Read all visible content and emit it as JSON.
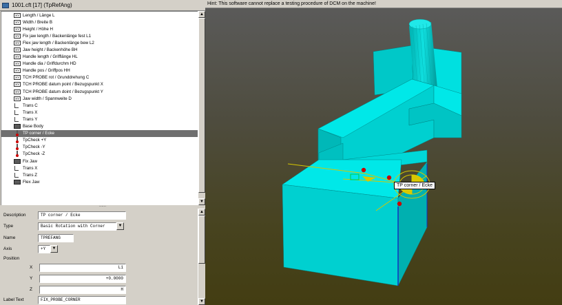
{
  "window": {
    "title": "1001.cft   [17]  (TpRefAng)"
  },
  "tree": {
    "items": [
      {
        "label": "Length / Länge L",
        "icon": "xy-variable-icon",
        "selected": false
      },
      {
        "label": "Width / Breite B",
        "icon": "xy-variable-icon",
        "selected": false
      },
      {
        "label": "Height / Höhe H",
        "icon": "xy-variable-icon",
        "selected": false
      },
      {
        "label": "Fix jaw length / Backenlänge fest L1",
        "icon": "xy-variable-icon",
        "selected": false
      },
      {
        "label": "Flex jaw length / Backenlänge bew L2",
        "icon": "xy-variable-icon",
        "selected": false
      },
      {
        "label": "Jaw height / Backenhöhe BH",
        "icon": "xy-variable-icon",
        "selected": false
      },
      {
        "label": "Handle length / Grifflänge HL",
        "icon": "xy-variable-icon",
        "selected": false
      },
      {
        "label": "Handle dia / Griffdurchm HD",
        "icon": "xy-variable-icon",
        "selected": false
      },
      {
        "label": "Handle pos / Griffpos HH",
        "icon": "xy-variable-icon",
        "selected": false
      },
      {
        "label": "TCH PROBE rot / Grunddrehung C",
        "icon": "xy-variable-icon",
        "selected": false
      },
      {
        "label": "TCH PROBE datum point / Bezugspunkt X",
        "icon": "xy-variable-icon",
        "selected": false
      },
      {
        "label": "TCH PROBE datum doint / Bezugspunkt Y",
        "icon": "xy-variable-icon",
        "selected": false
      },
      {
        "label": "Jaw width / Spannweite D",
        "icon": "xy-variable-icon",
        "selected": false
      },
      {
        "label": "Trans C",
        "icon": "transform-icon",
        "selected": false
      },
      {
        "label": "Trans X",
        "icon": "transform-icon",
        "selected": false
      },
      {
        "label": "Trans Y",
        "icon": "transform-icon",
        "selected": false
      },
      {
        "label": "Base Body",
        "icon": "body-icon",
        "selected": false
      },
      {
        "label": "TP corner / Ecke",
        "icon": "probe-icon",
        "selected": true
      },
      {
        "label": "TpCheck +Y",
        "icon": "probe-icon",
        "selected": false
      },
      {
        "label": "TpCheck -Y",
        "icon": "probe-icon",
        "selected": false
      },
      {
        "label": "TpCheck -Z",
        "icon": "probe-icon",
        "selected": false
      },
      {
        "label": "Fix Jaw",
        "icon": "body-icon",
        "selected": false
      },
      {
        "label": "Trans X",
        "icon": "transform-icon",
        "selected": false
      },
      {
        "label": "Trans Z",
        "icon": "transform-icon",
        "selected": false
      },
      {
        "label": "Flex Jaw",
        "icon": "body-icon",
        "selected": false
      }
    ]
  },
  "splitter": {
    "grip": "......"
  },
  "properties": {
    "description": {
      "label": "Description",
      "value": "TP corner / Ecke"
    },
    "type": {
      "label": "Type",
      "value": "Basic Rotation with Corner"
    },
    "name": {
      "label": "Name",
      "value": "TPREFANG"
    },
    "axis": {
      "label": "Axis",
      "value": "+Y"
    },
    "position": {
      "label": "Position",
      "x": {
        "label": "X",
        "value": "L1"
      },
      "y": {
        "label": "Y",
        "value": "+0.0000"
      },
      "z": {
        "label": "Z",
        "value": "H"
      }
    },
    "label_text": {
      "label": "Label Text",
      "value": "FIX_PROBE_CORNER"
    }
  },
  "viewport": {
    "hint": "Hint: This software cannot replace a testing procedure of DCM on the machine!",
    "tooltip": "TP corner / Ecke",
    "colors": {
      "model": "#00d8d8",
      "probe": "#cc0000",
      "selection": "#d8c800"
    }
  }
}
